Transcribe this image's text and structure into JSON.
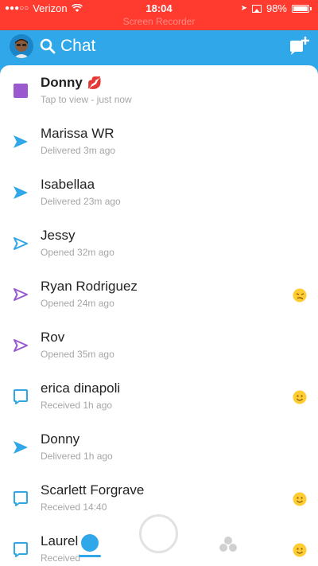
{
  "status_bar": {
    "carrier": "Verizon",
    "time": "18:04",
    "battery_text": "98%",
    "battery_level": 0.98,
    "recorder_label": "Screen Recorder"
  },
  "header": {
    "title": "Chat"
  },
  "chats": [
    {
      "name": "Donny",
      "name_emoji": "💋",
      "status": "Tap to view - just now",
      "icon": "snap-unopened-square-icon",
      "color": "#9b59d0",
      "bold": true
    },
    {
      "name": "Marissa WR",
      "status": "Delivered 3m ago",
      "icon": "delivered-arrow-icon",
      "color": "#2fa7e8"
    },
    {
      "name": "Isabellaa",
      "status": "Delivered 23m ago",
      "icon": "delivered-arrow-icon",
      "color": "#2fa7e8"
    },
    {
      "name": "Jessy",
      "status": "Opened 32m ago",
      "icon": "opened-arrow-outline-icon",
      "color": "#2fa7e8"
    },
    {
      "name": "Ryan Rodriguez",
      "status": "Opened 24m ago",
      "icon": "opened-arrow-outline-icon",
      "color": "#9b59d0",
      "emoji": "smirk-emoji-icon"
    },
    {
      "name": "Rov",
      "status": "Opened 35m ago",
      "icon": "opened-arrow-outline-icon",
      "color": "#9b59d0"
    },
    {
      "name": "erica dinapoli",
      "status": "Received 1h ago",
      "icon": "chat-bubble-outline-icon",
      "color": "#2fa7e8",
      "emoji": "smile-emoji-icon"
    },
    {
      "name": "Donny",
      "status": "Delivered 1h ago",
      "icon": "delivered-arrow-icon",
      "color": "#2fa7e8"
    },
    {
      "name": "Scarlett Forgrave",
      "status": "Received 14:40",
      "icon": "chat-bubble-outline-icon",
      "color": "#2fa7e8",
      "emoji": "smile-emoji-icon"
    },
    {
      "name": "Laurel",
      "status": "Received",
      "icon": "chat-bubble-outline-icon",
      "color": "#2fa7e8",
      "emoji": "smile-emoji-icon"
    }
  ],
  "colors": {
    "brand_blue": "#2fa7e8",
    "purple": "#9b59d0",
    "status_red": "#ff3b30"
  }
}
